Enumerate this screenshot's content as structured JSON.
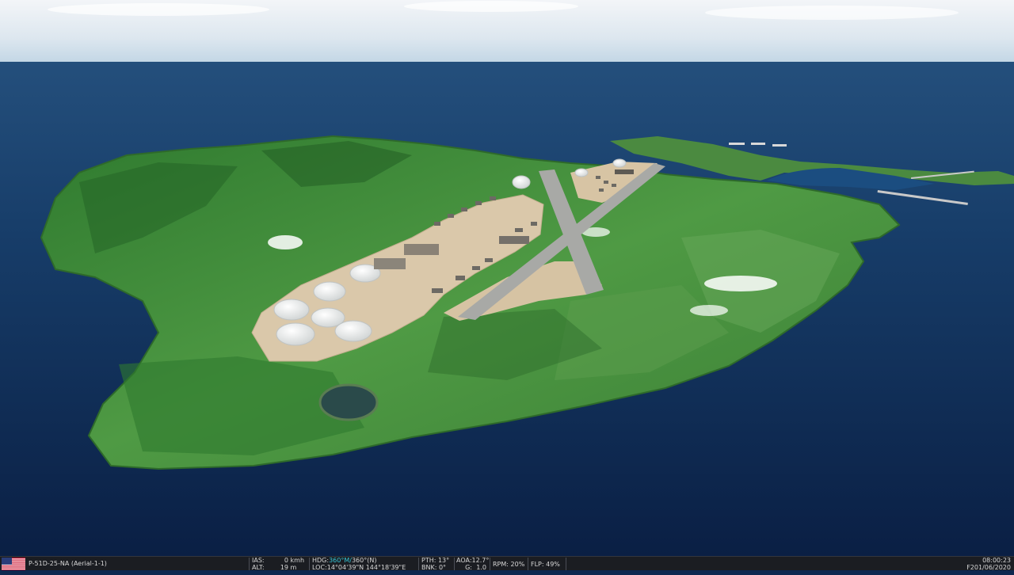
{
  "hud": {
    "flag": "us-flag-icon",
    "aircraft": "P-51D-25-NA (Aerial-1-1)",
    "ias_label": "IAS:",
    "ias_value": "0",
    "ias_unit": "kmh",
    "alt_label": "ALT:",
    "alt_value": "19",
    "alt_unit": "m",
    "hdg_label": "HDG:",
    "hdg_mag": "360°M/",
    "hdg_true": "360°(N)",
    "loc_label": "LOC:",
    "loc_value": "14°04'39\"N 144°18'39\"E",
    "pth_label": "PTH:",
    "pth_value": "13°",
    "bnk_label": "BNK:",
    "bnk_value": "0°",
    "aoa_label": "AOA:",
    "aoa_value": "12.7°",
    "g_label": "G:",
    "g_value": "1.0",
    "rpm_label": "RPM:",
    "rpm_value": "20%",
    "flp_label": "FLP:",
    "flp_value": "49%",
    "time": "08:00:23",
    "date": "F201/06/2020"
  },
  "colors": {
    "sky_top": "#eef2f6",
    "horizon": "#c9dbe8",
    "sea_far": "#1e4a7a",
    "sea_near": "#0b2247",
    "terrain": "#3f8a3a",
    "base_sand": "#d9c6a8",
    "runway": "#a8a9a6",
    "tank": "#eeeeee",
    "hud_bg": "#1b1d22",
    "hud_accent": "#36c7d8"
  }
}
